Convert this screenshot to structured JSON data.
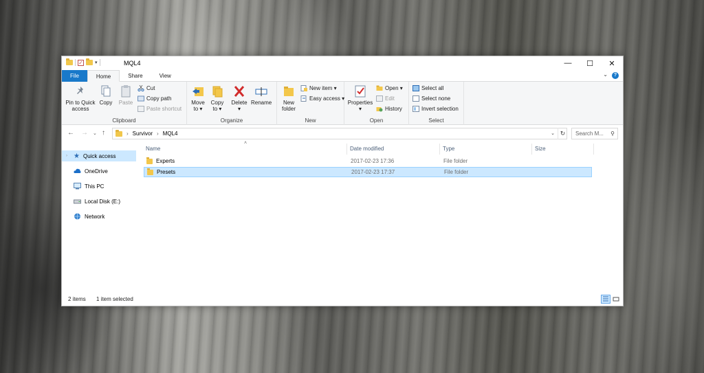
{
  "window": {
    "title": "MQL4",
    "controls": {
      "minimize": "—",
      "maximize": "☐",
      "close": "✕"
    }
  },
  "ribbon_tabs": [
    "File",
    "Home",
    "Share",
    "View"
  ],
  "clipboard": {
    "label": "Clipboard",
    "pin_line1": "Pin to Quick",
    "pin_line2": "access",
    "copy": "Copy",
    "paste": "Paste",
    "cut": "Cut",
    "copy_path": "Copy path",
    "paste_shortcut": "Paste shortcut"
  },
  "organize": {
    "label": "Organize",
    "move_line1": "Move",
    "move_line2": "to ▾",
    "copy_line1": "Copy",
    "copy_line2": "to ▾",
    "delete_line1": "Delete",
    "delete_line2": "▾",
    "rename": "Rename"
  },
  "new": {
    "label": "New",
    "folder_line1": "New",
    "folder_line2": "folder",
    "new_item": "New item ▾",
    "easy_access": "Easy access ▾"
  },
  "open": {
    "label": "Open",
    "properties": "Properties",
    "properties_arrow": "▾",
    "open": "Open ▾",
    "edit": "Edit",
    "history": "History"
  },
  "select": {
    "label": "Select",
    "select_all": "Select all",
    "select_none": "Select none",
    "invert": "Invert selection"
  },
  "address": {
    "crumbs": [
      "Survivor",
      "MQL4"
    ],
    "search_placeholder": "Search M..."
  },
  "nav_pane": [
    {
      "label": "Quick access",
      "icon": "star-icon"
    },
    {
      "label": "OneDrive",
      "icon": "cloud-icon"
    },
    {
      "label": "This PC",
      "icon": "computer-icon"
    },
    {
      "label": "Local Disk (E:)",
      "icon": "drive-icon"
    },
    {
      "label": "Network",
      "icon": "network-icon"
    }
  ],
  "columns": [
    "Name",
    "Date modified",
    "Type",
    "Size"
  ],
  "files": [
    {
      "name": "Experts",
      "date": "2017-02-23 17:36",
      "type": "File folder",
      "size": ""
    },
    {
      "name": "Presets",
      "date": "2017-02-23 17:37",
      "type": "File folder",
      "size": ""
    }
  ],
  "status": {
    "count": "2 items",
    "selected": "1 item selected"
  },
  "colors": {
    "accent": "#1979ca",
    "selection": "#cce8ff",
    "folder": "#f3c74b"
  }
}
